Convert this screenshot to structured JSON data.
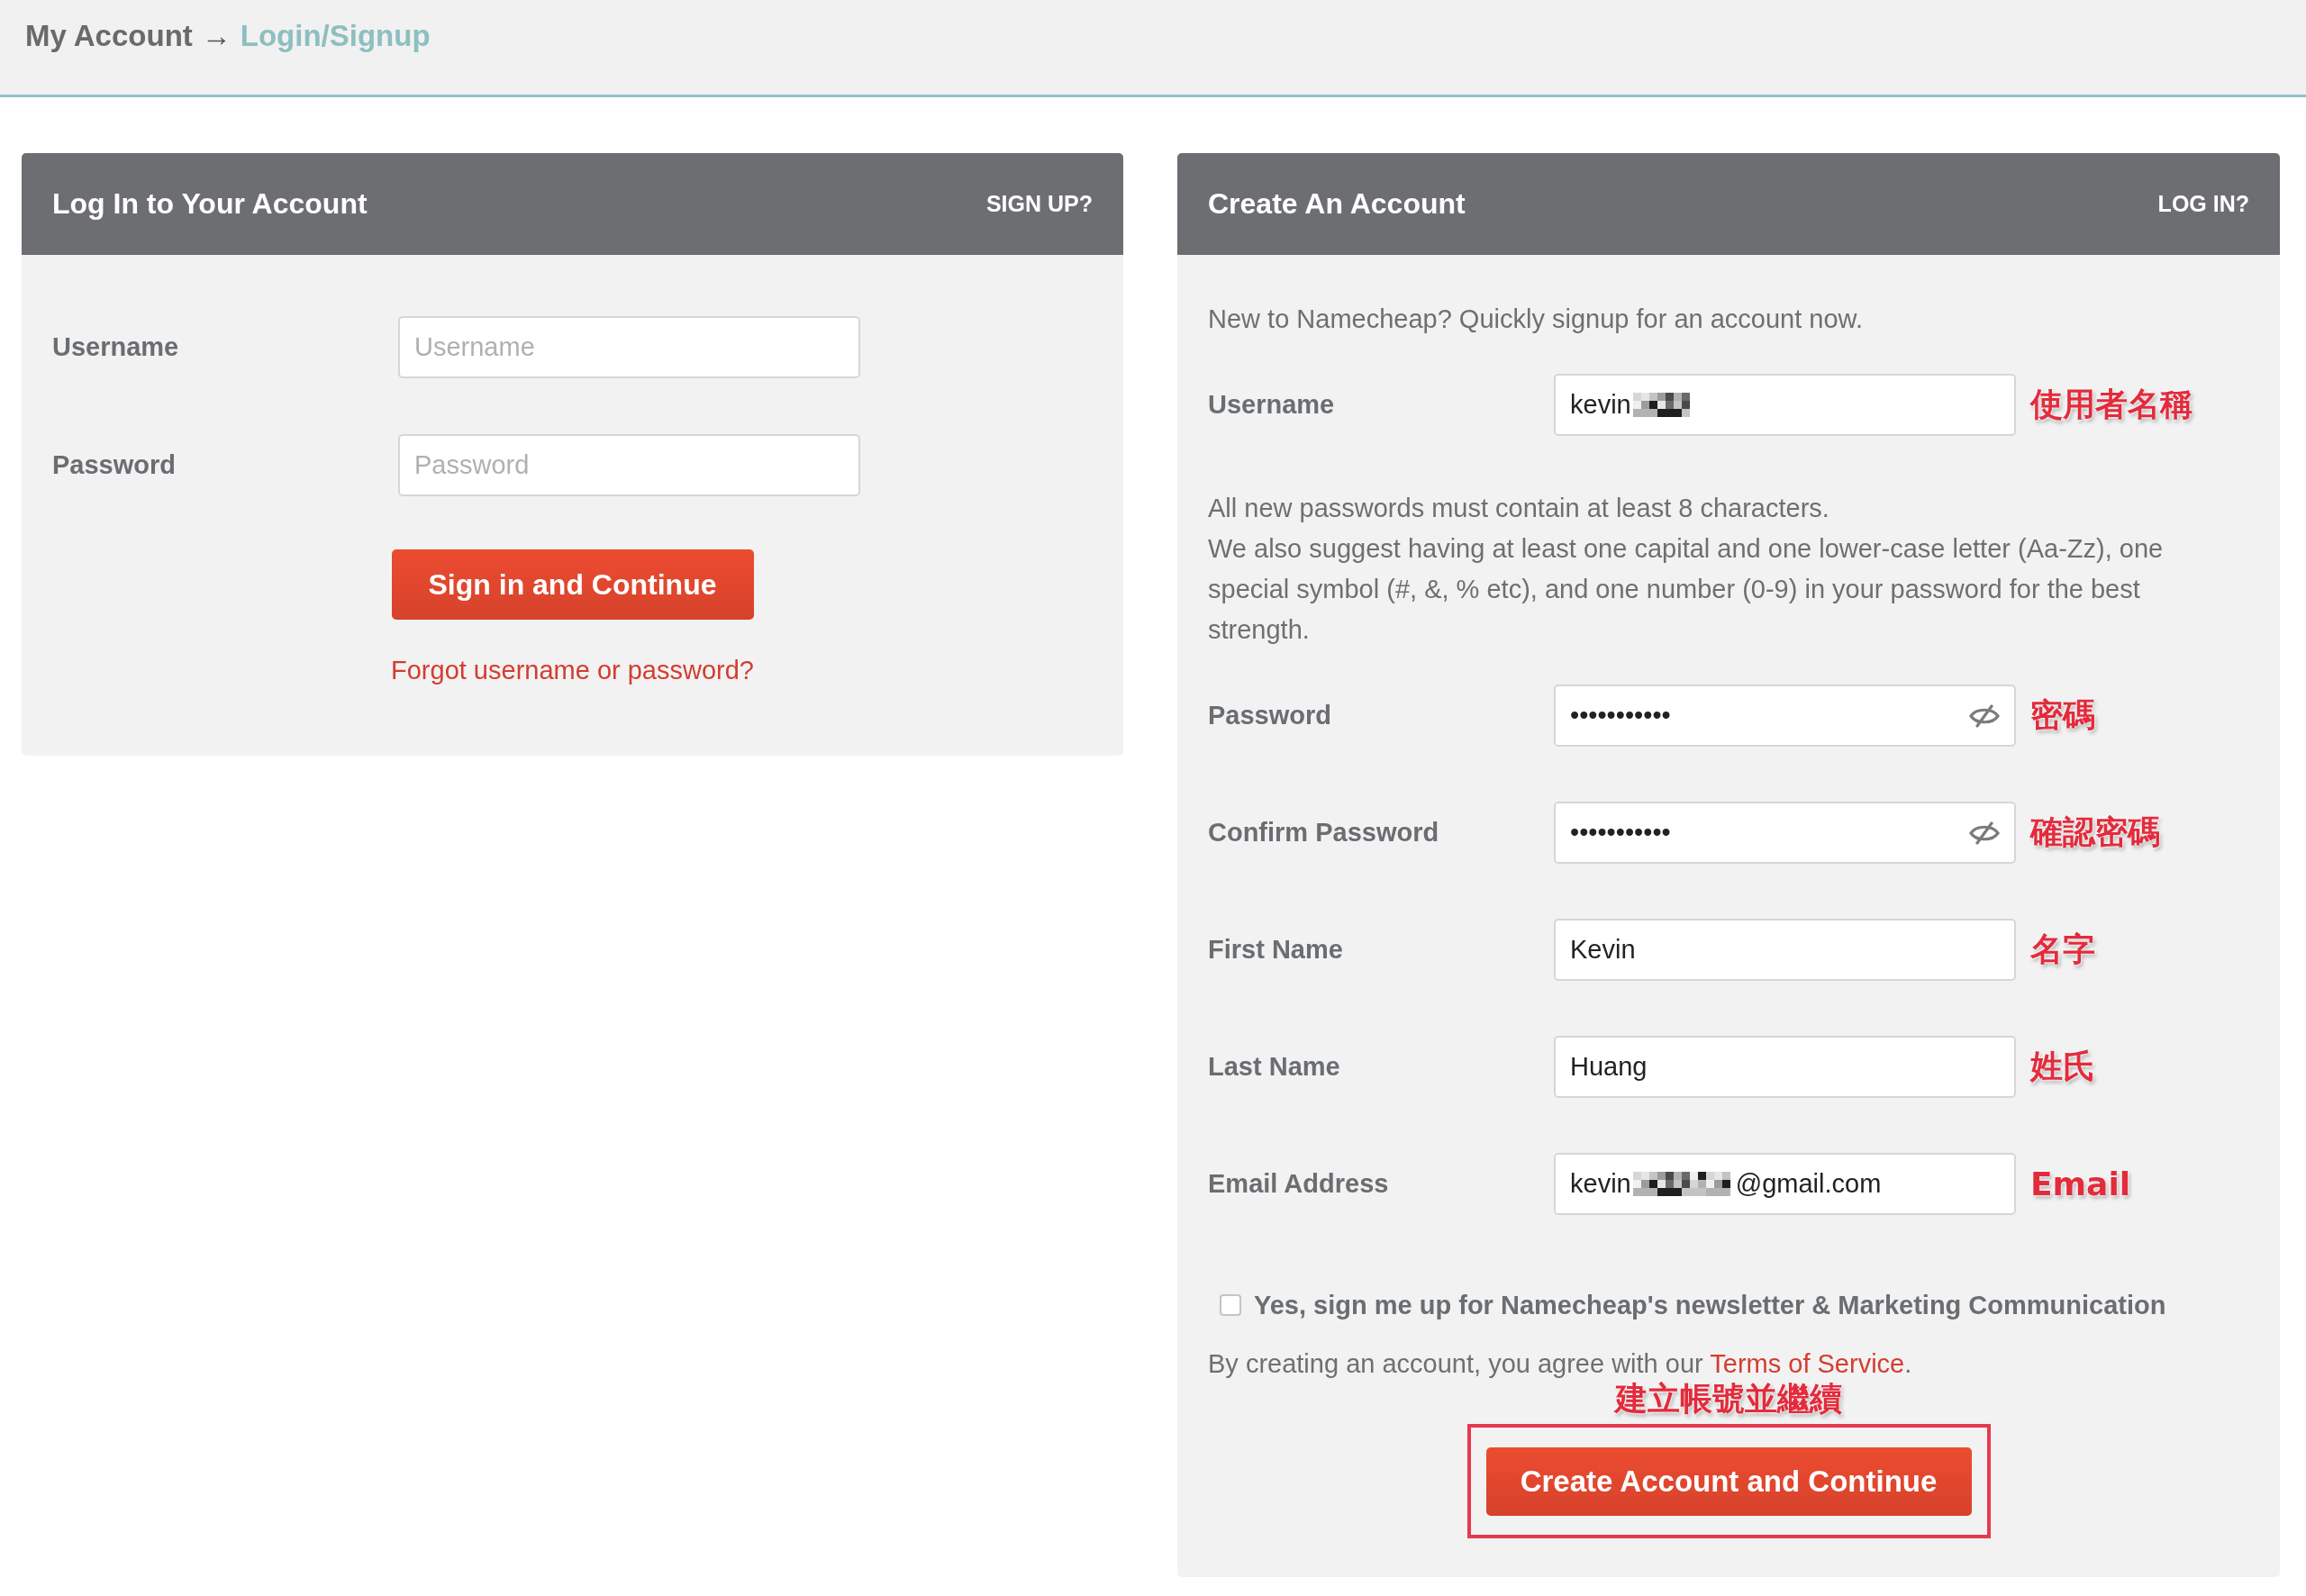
{
  "breadcrumb": {
    "separator": "→",
    "items": [
      {
        "label": "My Account",
        "selected": false
      },
      {
        "label": "Login/Signup",
        "selected": true
      }
    ]
  },
  "login_panel": {
    "title": "Log In to Your Account",
    "switch_link": "SIGN UP?",
    "fields": [
      {
        "label": "Username",
        "placeholder": "Username"
      },
      {
        "label": "Password",
        "placeholder": "Password"
      }
    ],
    "submit_button": "Sign in and Continue",
    "forgot_link": "Forgot username or password?"
  },
  "signup_panel": {
    "title": "Create An Account",
    "switch_link": "LOG IN?",
    "items": [
      {
        "kind": "note",
        "lines": [
          "New to Namecheap? Quickly signup for an account now."
        ]
      },
      {
        "kind": "field",
        "label": "Username",
        "value": "kevin",
        "redacted": true,
        "visibility_toggle": false,
        "annotation": "使用者名稱"
      },
      {
        "kind": "note",
        "lines": [
          "All new passwords must contain at least 8 characters.",
          "We also suggest having at least one capital and one lower-case letter (Aa-Zz), one special symbol (#, &, % etc), and one number (0-9) in your password for the best strength."
        ]
      },
      {
        "kind": "field",
        "label": "Password",
        "value": "•••••••••••",
        "redacted": false,
        "visibility_toggle": true,
        "annotation": "密碼"
      },
      {
        "kind": "field",
        "label": "Confirm Password",
        "value": "•••••••••••",
        "redacted": false,
        "visibility_toggle": true,
        "annotation": "確認密碼"
      },
      {
        "kind": "field",
        "label": "First Name",
        "value": "Kevin",
        "redacted": false,
        "visibility_toggle": false,
        "annotation": "名字"
      },
      {
        "kind": "field",
        "label": "Last Name",
        "value": "Huang",
        "redacted": false,
        "visibility_toggle": false,
        "annotation": "姓氏"
      },
      {
        "kind": "field",
        "label": "Email Address",
        "value": "kevin",
        "redacted": true,
        "value_end": "@gmail.com",
        "visibility_toggle": false,
        "annotation": "Email"
      }
    ],
    "newsletter": {
      "label": "Yes, sign me up for Namecheap's newsletter & Marketing Communication",
      "checked": false
    },
    "terms": {
      "text": "By creating an account, you agree with our",
      "link": "Terms of Service",
      "end": "."
    },
    "submit_annotation": "建立帳號並繼續",
    "submit_button": {
      "label": "Create Account and Continue",
      "highlighted": true
    }
  }
}
